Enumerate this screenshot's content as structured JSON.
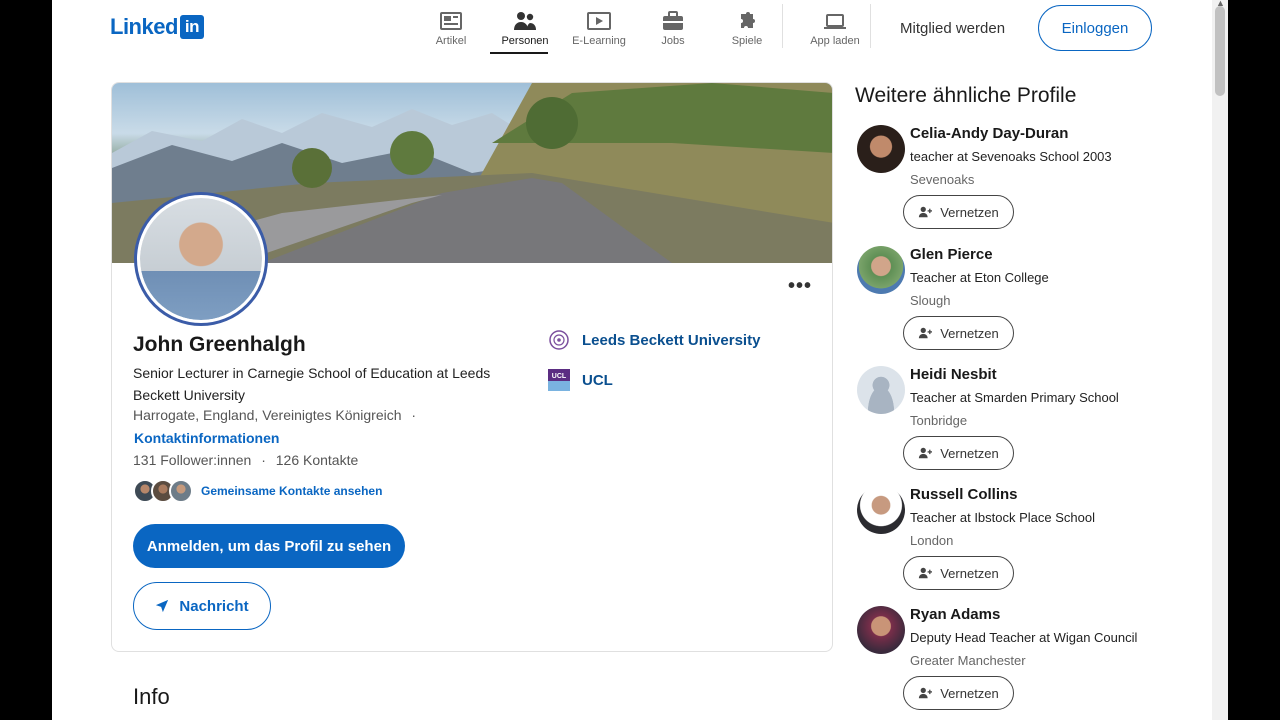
{
  "header": {
    "logo_text": "Linked",
    "logo_in": "in",
    "nav": [
      {
        "label": "Artikel",
        "icon": "article-icon"
      },
      {
        "label": "Personen",
        "icon": "people-icon"
      },
      {
        "label": "E-Learning",
        "icon": "elearning-icon"
      },
      {
        "label": "Jobs",
        "icon": "briefcase-icon"
      },
      {
        "label": "Spiele",
        "icon": "puzzle-icon"
      },
      {
        "label": "App laden",
        "icon": "laptop-icon"
      }
    ],
    "join": "Mitglied werden",
    "login": "Einloggen"
  },
  "profile": {
    "name": "John Greenhalgh",
    "headline": "Senior Lecturer in Carnegie School of Education at Leeds Beckett University",
    "location": "Harrogate, England, Vereinigtes Königreich",
    "separator": "·",
    "contact_info": "Kontaktinformationen",
    "followers": "131 Follower:innen",
    "stats_sep": "·",
    "connections": "126 Kontakte",
    "mutual": "Gemeinsame Kontakte ansehen",
    "signin_button": "Anmelden, um das Profil zu sehen",
    "message_button": "Nachricht",
    "more": "•••",
    "organizations": [
      {
        "name": "Leeds Beckett University"
      },
      {
        "name": "UCL",
        "logo_text": "UCL"
      }
    ]
  },
  "info_title": "Info",
  "sidebar": {
    "title": "Weitere ähnliche Profile",
    "connect_label": "Vernetzen",
    "people": [
      {
        "name": "Celia-Andy Day-Duran",
        "role": "teacher at Sevenoaks School 2003",
        "location": "Sevenoaks"
      },
      {
        "name": "Glen Pierce",
        "role": "Teacher at Eton College",
        "location": "Slough"
      },
      {
        "name": "Heidi Nesbit",
        "role": "Teacher at Smarden Primary School",
        "location": "Tonbridge"
      },
      {
        "name": "Russell Collins",
        "role": "Teacher at Ibstock Place School",
        "location": "London"
      },
      {
        "name": "Ryan Adams",
        "role": "Deputy Head Teacher at Wigan Council",
        "location": "Greater Manchester"
      }
    ]
  },
  "colors": {
    "brand": "#0a66c2",
    "text": "#191919",
    "muted": "#666666"
  }
}
